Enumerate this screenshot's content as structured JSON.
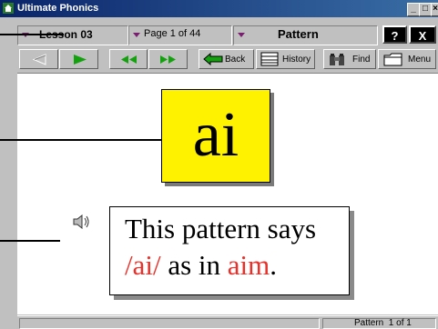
{
  "window": {
    "title": "Ultimate Phonics",
    "controls": [
      "_",
      "□",
      "×"
    ]
  },
  "selectors": {
    "lesson": "Lesson 03",
    "page": "Page 1 of 44",
    "mode": "Pattern"
  },
  "corner_buttons": {
    "help": "?",
    "close": "X"
  },
  "toolbar": {
    "back": "Back",
    "history": "History",
    "find": "Find",
    "menu": "Menu"
  },
  "content": {
    "pattern": "ai",
    "sentence_line1": "This pattern says",
    "sentence_sound": "/ai/",
    "sentence_mid": " as in ",
    "sentence_word": "aim",
    "sentence_end": "."
  },
  "status": {
    "right": "Pattern  1 of 1"
  },
  "colors": {
    "highlight": "#fff200",
    "accent_red": "#e8312b",
    "play_green": "#13a10e"
  }
}
